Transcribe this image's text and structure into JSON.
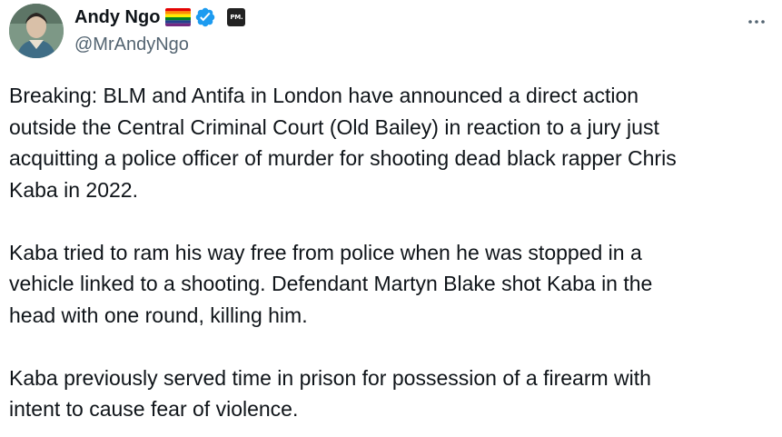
{
  "author": {
    "display_name": "Andy Ngo",
    "handle": "@MrAndyNgo",
    "badge_text": "PM."
  },
  "icons": {
    "flag": "rainbow-flag-icon",
    "verified": "verified-badge-icon",
    "affiliate": "affiliate-badge-icon",
    "more": "more-options-icon"
  },
  "colors": {
    "verified": "#1d9bf0",
    "text": "#0f1419",
    "secondary": "#536471"
  },
  "tweet": {
    "paragraphs": [
      "Breaking: BLM and Antifa in London have announced a direct action\noutside the Central Criminal Court (Old Bailey) in reaction to a jury just\nacquitting a police officer of murder for shooting dead black rapper Chris\nKaba in 2022.",
      "Kaba tried to ram his way free from police when he was stopped in a\nvehicle linked to a shooting. Defendant Martyn Blake shot Kaba in the\nhead with one round, killing him.",
      "Kaba previously served time in prison for possession of a firearm with\nintent to cause fear of violence."
    ]
  }
}
